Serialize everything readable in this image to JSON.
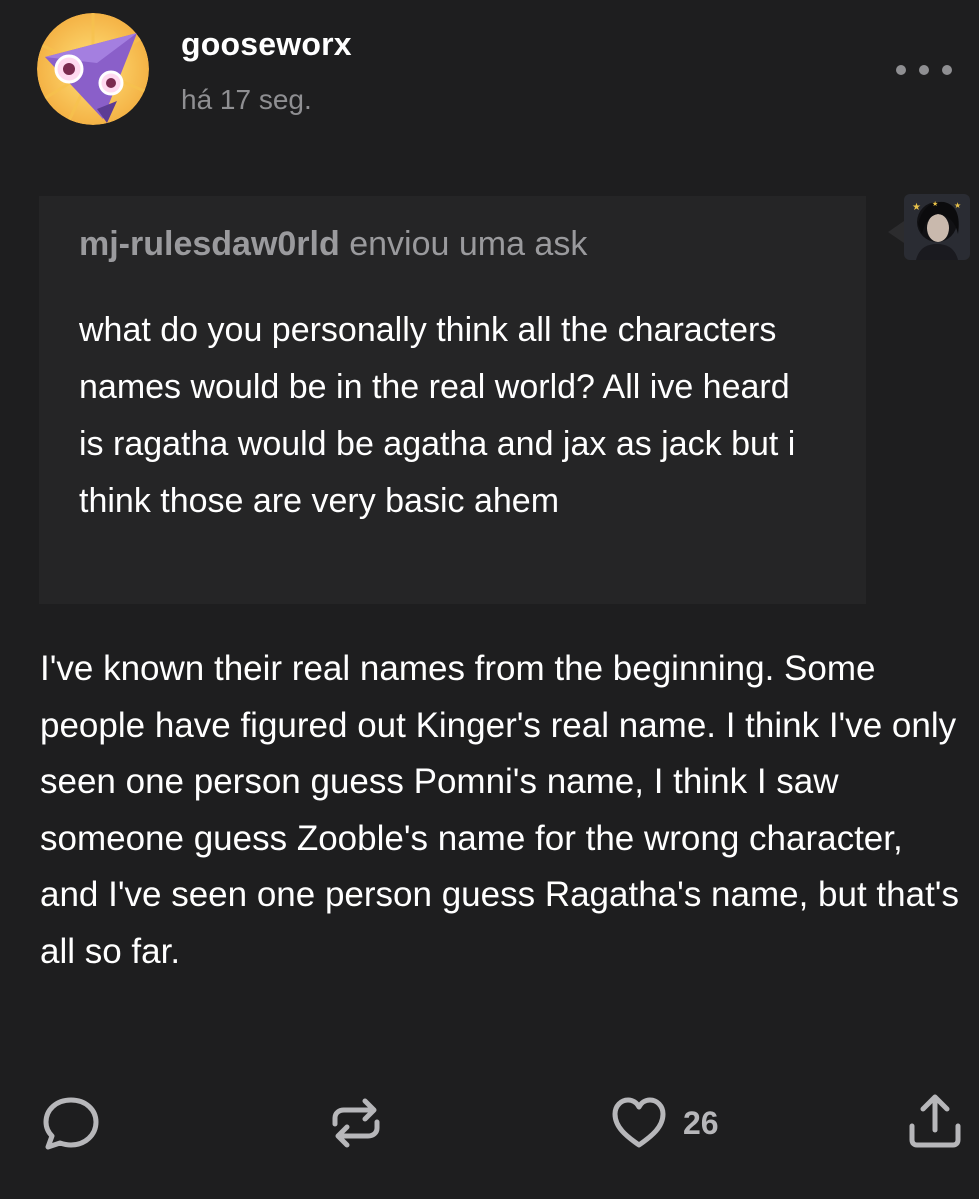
{
  "post": {
    "author": {
      "username": "gooseworx",
      "avatar_icon": "gooseworx-avatar-icon"
    },
    "timestamp": "há 17 seg.",
    "more_icon": "more-horizontal-icon",
    "ask": {
      "asker_name": "mj-rulesdaw0rld",
      "asker_action": " enviou uma ask",
      "asker_avatar_icon": "asker-avatar-icon",
      "question": "what do you personally think all the characters names would be in the real world? All ive heard is ragatha would be agatha and jax as jack but i think those are very basic ahem"
    },
    "answer": "I've known their real names from the beginning. Some people have figured out Kinger's real name. I think I've only seen one person guess Pomni's name, I think I saw someone guess Zooble's name for the wrong character, and I've seen one person guess Ragatha's name, but that's all so far.",
    "actions": {
      "reply_icon": "reply-bubble-icon",
      "reblog_icon": "reblog-icon",
      "like_icon": "heart-icon",
      "like_count": "26",
      "share_icon": "share-icon"
    }
  },
  "colors": {
    "background": "#1e1e1f",
    "ask_background": "#252526",
    "muted_text": "#8f8f92",
    "icon": "#b7b7ba",
    "text": "#ffffff"
  }
}
